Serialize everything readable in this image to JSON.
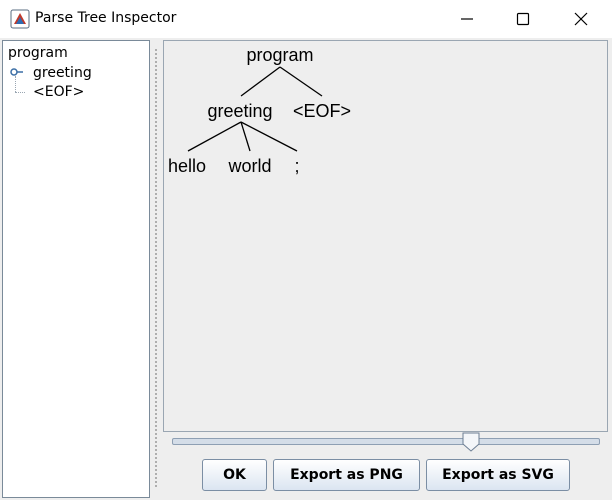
{
  "window": {
    "title": "Parse Tree Inspector"
  },
  "tree": {
    "root": "program",
    "children": [
      "greeting",
      "<EOF>"
    ]
  },
  "parse_tree": {
    "root": "program",
    "level1": [
      "greeting",
      "<EOF>"
    ],
    "level2": [
      "hello",
      "world",
      ";"
    ]
  },
  "zoom": {
    "level": 0.7
  },
  "buttons": {
    "ok": "OK",
    "export_png": "Export as PNG",
    "export_svg": "Export as SVG"
  }
}
